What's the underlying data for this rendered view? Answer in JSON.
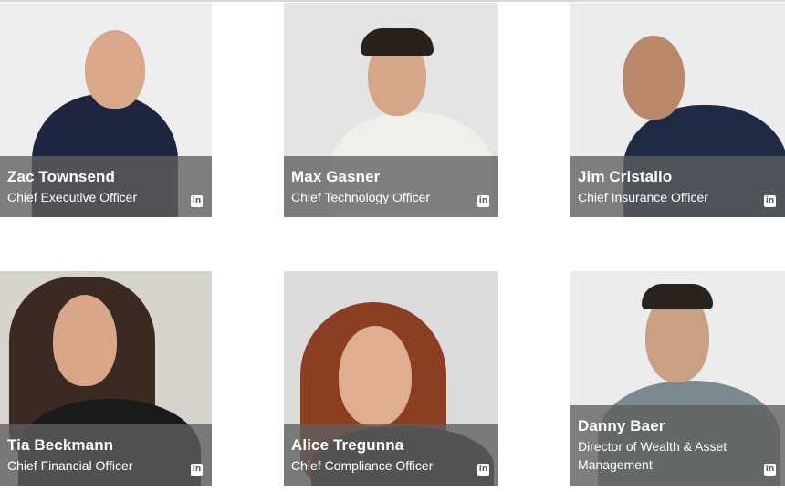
{
  "team": [
    {
      "name": "Zac Townsend",
      "title": "Chief Executive Officer",
      "icon": "linkedin-icon",
      "icon_text": "in"
    },
    {
      "name": "Max Gasner",
      "title": "Chief Technology Officer",
      "icon": "linkedin-icon",
      "icon_text": "in"
    },
    {
      "name": "Jim Cristallo",
      "title": "Chief Insurance Officer",
      "icon": "linkedin-icon",
      "icon_text": "in"
    },
    {
      "name": "Tia Beckmann",
      "title": "Chief Financial Officer",
      "icon": "linkedin-icon",
      "icon_text": "in"
    },
    {
      "name": "Alice Tregunna",
      "title": "Chief Compliance Officer",
      "icon": "linkedin-icon",
      "icon_text": "in"
    },
    {
      "name": "Danny Baer",
      "title": "Director of Wealth & Asset Management",
      "icon": "linkedin-icon",
      "icon_text": "in"
    }
  ],
  "colors": {
    "caption_overlay": "#5f5f5f",
    "caption_text": "#ffffff",
    "photo_background": "#e9e9e9"
  }
}
